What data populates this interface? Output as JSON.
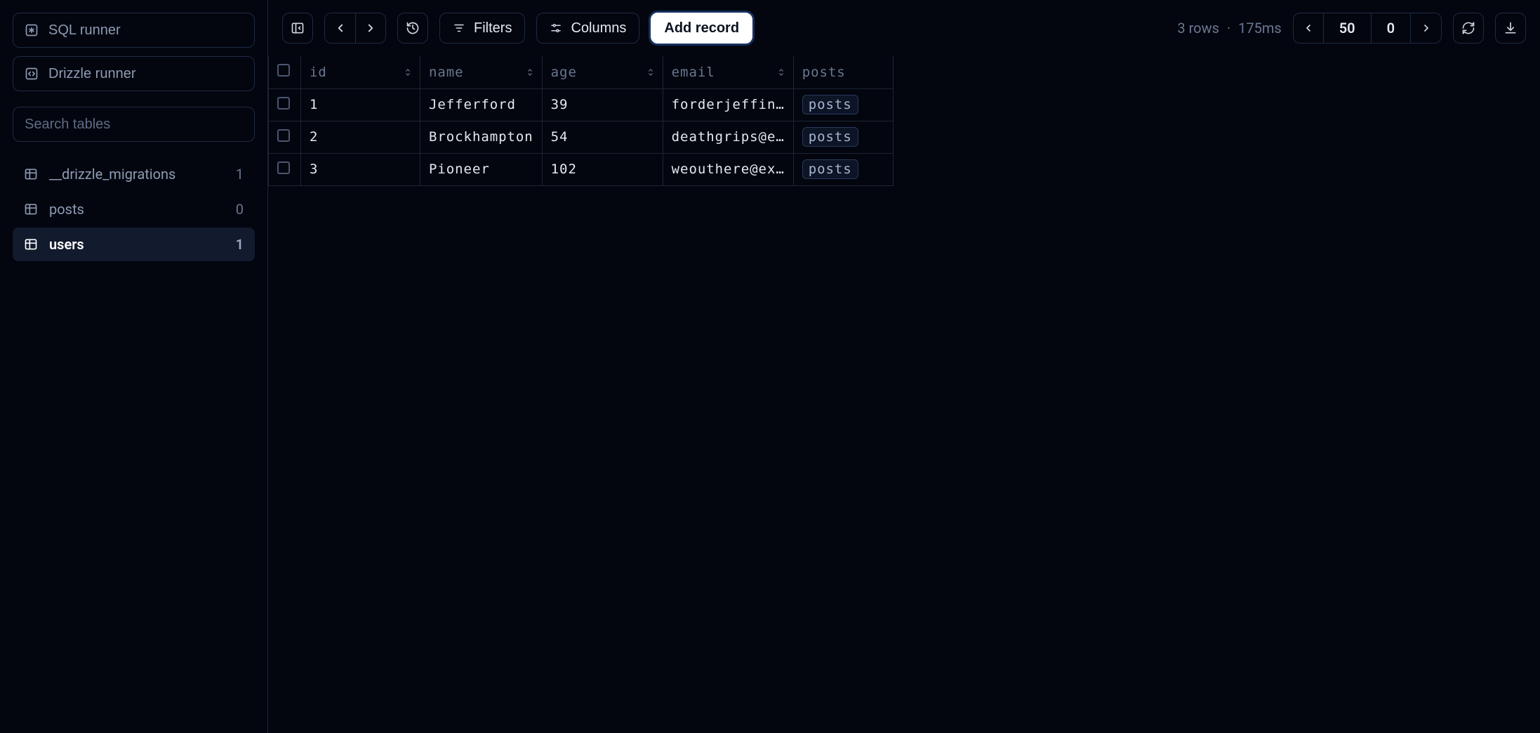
{
  "sidebar": {
    "sql_runner_label": "SQL runner",
    "drizzle_runner_label": "Drizzle runner",
    "search_placeholder": "Search tables",
    "tables": [
      {
        "name": "__drizzle_migrations",
        "count": "1",
        "active": false
      },
      {
        "name": "posts",
        "count": "0",
        "active": false
      },
      {
        "name": "users",
        "count": "1",
        "active": true
      }
    ]
  },
  "toolbar": {
    "filters_label": "Filters",
    "columns_label": "Columns",
    "add_record_label": "Add record",
    "status_rows": "3 rows",
    "status_separator": "·",
    "status_time": "175ms",
    "page_size": "50",
    "page_offset": "0"
  },
  "table": {
    "columns": [
      {
        "key": "id",
        "label": "id",
        "sortable": true
      },
      {
        "key": "name",
        "label": "name",
        "sortable": true
      },
      {
        "key": "age",
        "label": "age",
        "sortable": true
      },
      {
        "key": "email",
        "label": "email",
        "sortable": true
      },
      {
        "key": "posts",
        "label": "posts",
        "sortable": false
      }
    ],
    "rows": [
      {
        "id": "1",
        "name": "Jefferford",
        "age": "39",
        "email": "forderjeffin…",
        "posts_label": "posts"
      },
      {
        "id": "2",
        "name": "Brockhampton",
        "age": "54",
        "email": "deathgrips@e…",
        "posts_label": "posts"
      },
      {
        "id": "3",
        "name": "Pioneer",
        "age": "102",
        "email": "weouthere@ex…",
        "posts_label": "posts"
      }
    ]
  }
}
